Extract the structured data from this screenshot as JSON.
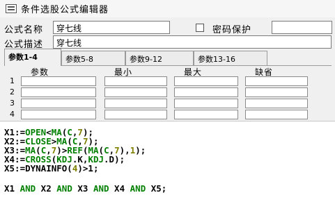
{
  "window": {
    "title": "条件选股公式编辑器"
  },
  "form": {
    "name_label": "公式名称",
    "name_value": "穿七线",
    "password_label": "密码保护",
    "password_value": "",
    "desc_label": "公式描述",
    "desc_value": "穿七线"
  },
  "tabs": [
    {
      "label": "参数1-4",
      "active": true
    },
    {
      "label": "参数5-8",
      "active": false
    },
    {
      "label": "参数9-12",
      "active": false
    },
    {
      "label": "参数13-16",
      "active": false
    }
  ],
  "params": {
    "headers": [
      "参数",
      "最小",
      "最大",
      "缺省"
    ],
    "rows": [
      "1",
      "2",
      "3",
      "4"
    ]
  },
  "code": {
    "lines": [
      [
        [
          "X1:=",
          "pl"
        ],
        [
          "OPEN",
          "kw"
        ],
        [
          "<",
          "pl"
        ],
        [
          "MA",
          "kw"
        ],
        [
          "(",
          "pl"
        ],
        [
          "C",
          "kw"
        ],
        [
          ",",
          "pl"
        ],
        [
          "7",
          "num"
        ],
        [
          ");",
          "pl"
        ]
      ],
      [
        [
          "X2:=",
          "pl"
        ],
        [
          "CLOSE",
          "kw"
        ],
        [
          ">",
          "pl"
        ],
        [
          "MA",
          "kw"
        ],
        [
          "(",
          "pl"
        ],
        [
          "C",
          "kw"
        ],
        [
          ",",
          "pl"
        ],
        [
          "7",
          "num"
        ],
        [
          ");",
          "pl"
        ]
      ],
      [
        [
          "X3:=",
          "pl"
        ],
        [
          "MA",
          "kw"
        ],
        [
          "(",
          "pl"
        ],
        [
          "C",
          "kw"
        ],
        [
          ",",
          "pl"
        ],
        [
          "7",
          "num"
        ],
        [
          ")>",
          "pl"
        ],
        [
          "REF",
          "kw"
        ],
        [
          "(",
          "pl"
        ],
        [
          "MA",
          "kw"
        ],
        [
          "(",
          "pl"
        ],
        [
          "C",
          "kw"
        ],
        [
          ",",
          "pl"
        ],
        [
          "7",
          "num"
        ],
        [
          "),",
          "pl"
        ],
        [
          "1",
          "num"
        ],
        [
          ");",
          "pl"
        ]
      ],
      [
        [
          "X4:=",
          "pl"
        ],
        [
          "CROSS",
          "kw"
        ],
        [
          "(",
          "pl"
        ],
        [
          "KDJ",
          "kw"
        ],
        [
          ".K,",
          "pl"
        ],
        [
          "KDJ",
          "kw"
        ],
        [
          ".D);",
          "pl"
        ]
      ],
      [
        [
          "X5:=DYNAINFO(",
          "pl"
        ],
        [
          "4",
          "num"
        ],
        [
          ")>1;",
          "pl"
        ]
      ],
      [
        [
          "",
          "pl"
        ]
      ],
      [
        [
          "X1 ",
          "pl"
        ],
        [
          "AND",
          "kw"
        ],
        [
          " X2 ",
          "pl"
        ],
        [
          "AND",
          "kw"
        ],
        [
          " X3 ",
          "pl"
        ],
        [
          "AND",
          "kw"
        ],
        [
          " X4 ",
          "pl"
        ],
        [
          "AND",
          "kw"
        ],
        [
          " X5;",
          "pl"
        ]
      ]
    ]
  }
}
